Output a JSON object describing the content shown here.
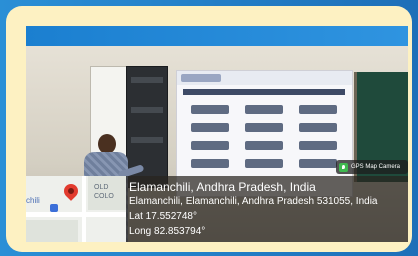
{
  "badge": {
    "label": "GPS Map Camera"
  },
  "location": {
    "title": "Elamanchili, Andhra Pradesh, India",
    "address": "Elamanchili, Elamanchili, Andhra Pradesh 531055, India",
    "lat": "Lat 17.552748°",
    "long": "Long 82.853794°"
  },
  "map": {
    "label_left": "chili",
    "label_right_1": "OLD",
    "label_right_2": "COLO"
  },
  "colors": {
    "outer_background": "#2a8fd6",
    "frame": "#fdf1c2",
    "banner": "#1b7fd0",
    "pin": "#e23b2e"
  }
}
